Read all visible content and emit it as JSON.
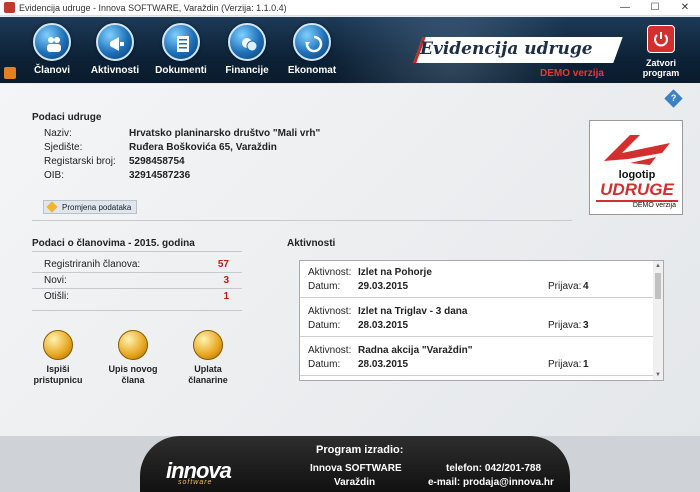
{
  "window": {
    "title": "Evidencija udruge - Innova SOFTWARE, Varaždin (Verzija: 1.1.0.4)",
    "minimize": "—",
    "maximize": "☐",
    "close": "✕"
  },
  "toolbar": {
    "items": [
      {
        "label": "Članovi",
        "icon": "members-icon"
      },
      {
        "label": "Aktivnosti",
        "icon": "megaphone-icon"
      },
      {
        "label": "Dokumenti",
        "icon": "documents-icon"
      },
      {
        "label": "Financije",
        "icon": "coins-icon"
      },
      {
        "label": "Ekonomat",
        "icon": "recycle-icon"
      }
    ],
    "brand": "Evidencija udruge",
    "demo": "DEMO verzija",
    "exit_label": "Zatvori program"
  },
  "org": {
    "section_title": "Podaci udruge",
    "fields": [
      {
        "label": "Naziv:",
        "value": "Hrvatsko planinarsko društvo \"Mali vrh\""
      },
      {
        "label": "Sjedište:",
        "value": "Ruđera Boškovića 65, Varaždin"
      },
      {
        "label": "Registarski broj:",
        "value": "5298458754"
      },
      {
        "label": "OIB:",
        "value": "32914587236"
      }
    ],
    "edit_label": "Promjena podataka"
  },
  "logo": {
    "line1": "logotip",
    "line2": "UDRUGE",
    "line3": "DEMO verzija"
  },
  "members": {
    "section_title": "Podaci o članovima - 2015. godina",
    "stats": [
      {
        "label": "Registriranih članova:",
        "value": "57"
      },
      {
        "label": "Novi:",
        "value": "3"
      },
      {
        "label": "Otišli:",
        "value": "1"
      }
    ],
    "actions": [
      {
        "label1": "Ispiši",
        "label2": "pristupnicu"
      },
      {
        "label1": "Upis novog",
        "label2": "člana"
      },
      {
        "label1": "Uplata",
        "label2": "članarine"
      }
    ]
  },
  "activities": {
    "section_title": "Aktivnosti",
    "activity_label": "Aktivnost:",
    "date_label": "Datum:",
    "apps_label": "Prijava:",
    "items": [
      {
        "name": "Izlet na Pohorje",
        "date": "29.03.2015",
        "apps": "4"
      },
      {
        "name": "Izlet na Triglav - 3 dana",
        "date": "28.03.2015",
        "apps": "3"
      },
      {
        "name": "Radna akcija \"Varaždin\"",
        "date": "28.03.2015",
        "apps": "1"
      }
    ]
  },
  "footer": {
    "made_by": "Program izradio:",
    "logo_main": "innova",
    "logo_sub": "software",
    "company": "Innova SOFTWARE",
    "city": "Varaždin",
    "phone": "telefon: 042/201-788",
    "email": "e-mail: prodaja@innova.hr"
  }
}
